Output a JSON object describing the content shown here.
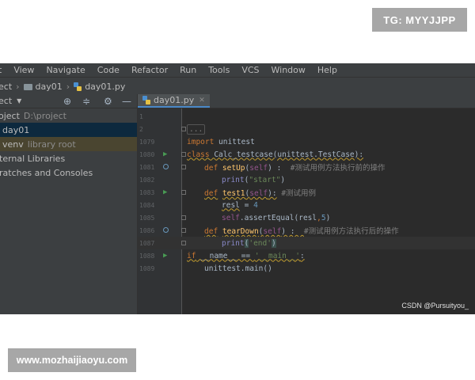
{
  "tags": {
    "top": "TG: MYYJJPP",
    "bottom": "www.mozhaijiaoyu.com"
  },
  "menu": [
    "t",
    "View",
    "Navigate",
    "Code",
    "Refactor",
    "Run",
    "Tools",
    "VCS",
    "Window",
    "Help"
  ],
  "breadcrumb": {
    "root": "ect",
    "folder": "day01",
    "file": "day01.py"
  },
  "sidebar": {
    "header": "ect",
    "tree": [
      {
        "label": "oject",
        "suffix": "D:\\project",
        "state": "normal"
      },
      {
        "label": "day01",
        "suffix": "",
        "state": "selected"
      },
      {
        "label": "venv",
        "suffix": "library root",
        "state": "venv"
      },
      {
        "label": "ternal Libraries",
        "suffix": "",
        "state": "normal"
      },
      {
        "label": "ratches and Consoles",
        "suffix": "",
        "state": "normal"
      }
    ]
  },
  "editor": {
    "tab": "day01.py",
    "lines": [
      {
        "num": "1",
        "text": ""
      },
      {
        "num": "2",
        "text": "..."
      },
      {
        "num": "1079",
        "text": "import unittest"
      },
      {
        "num": "1080",
        "text": "class Calc_testcase(unittest.TestCase):"
      },
      {
        "num": "1081",
        "text": "    def setUp(self) :  #测试用例方法执行前的操作"
      },
      {
        "num": "1082",
        "text": "        print(\"start\")"
      },
      {
        "num": "1083",
        "text": "    def test1(self): #测试用例"
      },
      {
        "num": "1084",
        "text": "        resl = 4"
      },
      {
        "num": "1085",
        "text": "        self.assertEqual(resl,5)"
      },
      {
        "num": "1086",
        "text": "    def tearDown(self) :  #测试用例方法执行后的操作"
      },
      {
        "num": "1087",
        "text": "        print('end')"
      },
      {
        "num": "1088",
        "text": "if __name__ == '__main__':"
      },
      {
        "num": "1089",
        "text": "    unittest.main()"
      }
    ]
  },
  "watermark": "CSDN @Pursuityou_",
  "colors": {
    "ide_bg": "#2b2b2b",
    "panel_bg": "#3c3f41",
    "keyword": "#cc7832",
    "function": "#ffc66d",
    "string": "#6a8759",
    "run_icon": "#499c54"
  }
}
